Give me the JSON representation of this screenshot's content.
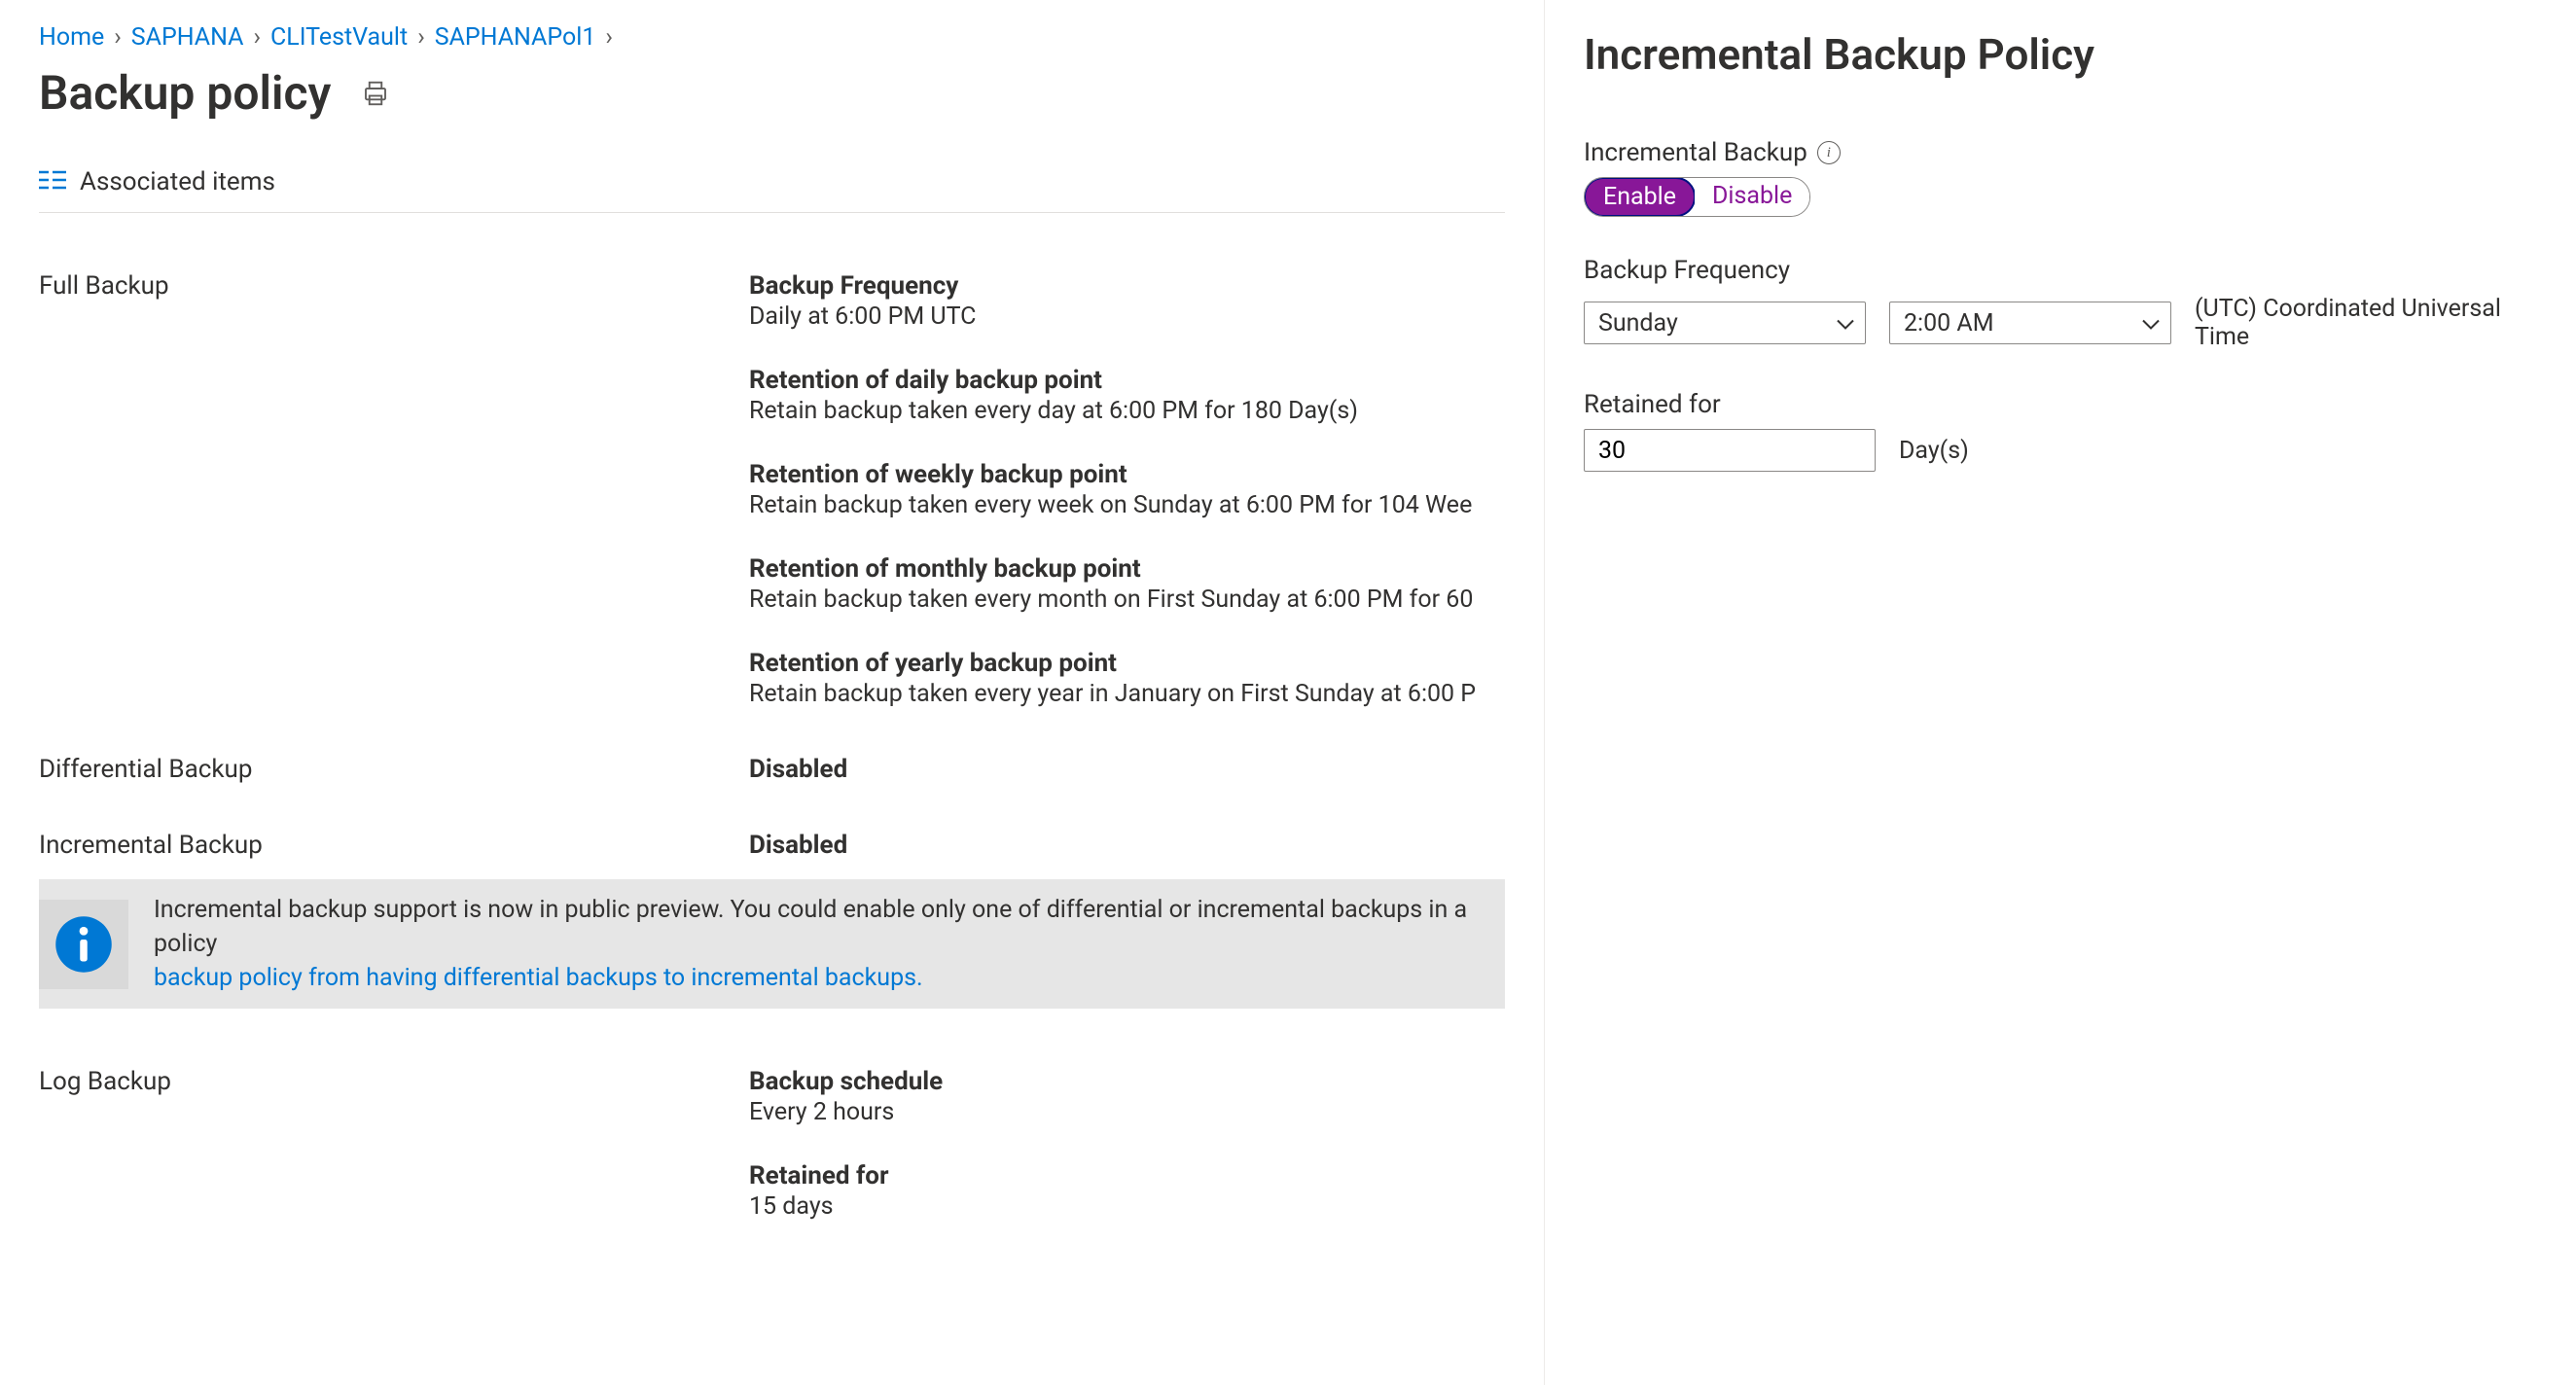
{
  "breadcrumb": {
    "items": [
      "Home",
      "SAPHANA",
      "CLITestVault",
      "SAPHANAPol1"
    ]
  },
  "page_title": "Backup policy",
  "associated_items_label": "Associated items",
  "sections": {
    "full": {
      "label": "Full Backup",
      "items": [
        {
          "label": "Backup Frequency",
          "value": "Daily at 6:00 PM UTC"
        },
        {
          "label": "Retention of daily backup point",
          "value": "Retain backup taken every day at 6:00 PM for 180 Day(s)"
        },
        {
          "label": "Retention of weekly backup point",
          "value": "Retain backup taken every week on Sunday at 6:00 PM for 104 Wee"
        },
        {
          "label": "Retention of monthly backup point",
          "value": "Retain backup taken every month on First Sunday at 6:00 PM for 60"
        },
        {
          "label": "Retention of yearly backup point",
          "value": "Retain backup taken every year in January on First Sunday at 6:00 P"
        }
      ]
    },
    "differential": {
      "label": "Differential Backup",
      "status": "Disabled"
    },
    "incremental": {
      "label": "Incremental Backup",
      "status": "Disabled"
    },
    "log": {
      "label": "Log Backup",
      "items": [
        {
          "label": "Backup schedule",
          "value": "Every 2 hours"
        },
        {
          "label": "Retained for",
          "value": "15 days"
        }
      ]
    }
  },
  "banner": {
    "text_prefix": "Incremental backup support is now in public preview. You could enable only one of differential or incremental backups in a policy",
    "link_text": "backup policy from having differential backups to incremental backups."
  },
  "panel": {
    "title": "Incremental Backup Policy",
    "toggle_label": "Incremental Backup",
    "toggle_enable": "Enable",
    "toggle_disable": "Disable",
    "frequency_label": "Backup Frequency",
    "day_value": "Sunday",
    "time_value": "2:00 AM",
    "timezone": "(UTC) Coordinated Universal Time",
    "retained_label": "Retained for",
    "retained_value": "30",
    "retained_unit": "Day(s)"
  }
}
